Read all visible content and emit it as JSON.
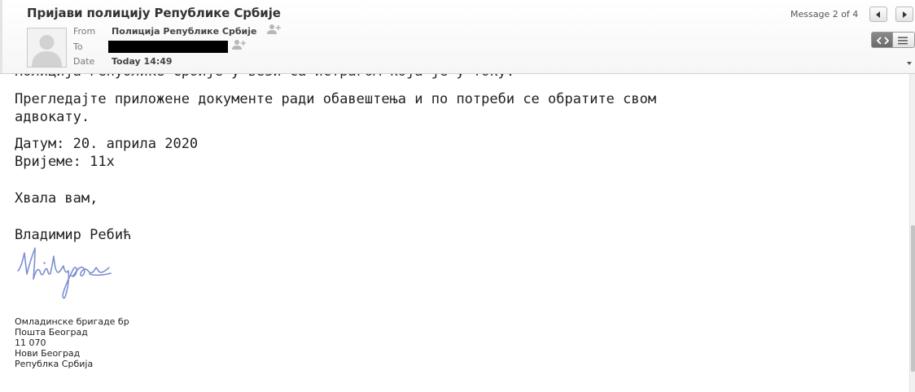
{
  "header": {
    "subject": "Пријави полицију Републике Србије",
    "from_label": "From",
    "from_value": "Полиција Републике Србије",
    "to_label": "To",
    "date_label": "Date",
    "date_value": "Today 14:49",
    "message_counter": "Message 2 of 4"
  },
  "icons": {
    "avatar": "person-placeholder-icon",
    "add_contact": "add-contact-icon",
    "prev": "arrow-left-icon",
    "next": "arrow-right-icon",
    "html_view": "code-view-icon",
    "plain_view": "text-lines-icon",
    "scroll_down": "chevron-down-icon"
  },
  "body": {
    "line_cut": "Полиција Републике Србије у вези са истрагом која је у току.",
    "para1_line1": "Прегледајте приложене документе ради обавештења и по потреби се обратите свом",
    "para1_line2": "адвокату.",
    "date_line": "Датум: 20. априла 2020",
    "time_line": "Вријеме: 11х",
    "thanks": "Хвала вам,",
    "signer": "Владимир Ребић",
    "address": [
      "Омладинске бригаде бр",
      "Пошта Београд",
      "11 070",
      "Нови Београд",
      "Републка Србија"
    ]
  },
  "colors": {
    "signature_ink": "#7e8fd0"
  }
}
